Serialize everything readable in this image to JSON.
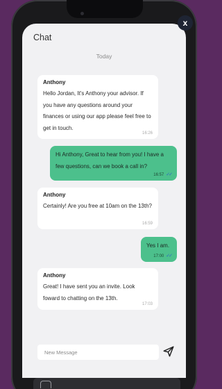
{
  "close_label": "x",
  "chat": {
    "title": "Chat",
    "day_label": "Today",
    "input_placeholder": "New Message"
  },
  "messages": [
    {
      "direction": "incoming",
      "sender": "Anthony",
      "text": "Hello Jordan, It's Anthony your advisor. If you have any questions around your finances or using our app please feel free to get in touch.",
      "time": "16:26"
    },
    {
      "direction": "outgoing",
      "text": "Hi Anthony, Great to hear from you! I have a few questions, can we book a call in?",
      "time": "16:57",
      "ticks": "✓✓"
    },
    {
      "direction": "incoming",
      "sender": "Anthony",
      "text": "Certainly! Are you free at 10am on the 13th?",
      "time": "16:59"
    },
    {
      "direction": "outgoing",
      "text": "Yes I am.",
      "time": "17:00",
      "ticks": "✓✓"
    },
    {
      "direction": "incoming",
      "sender": "Anthony",
      "text": "Great! I have sent you an invite. Look foward to chatting on the 13th.",
      "time": "17:03"
    }
  ]
}
